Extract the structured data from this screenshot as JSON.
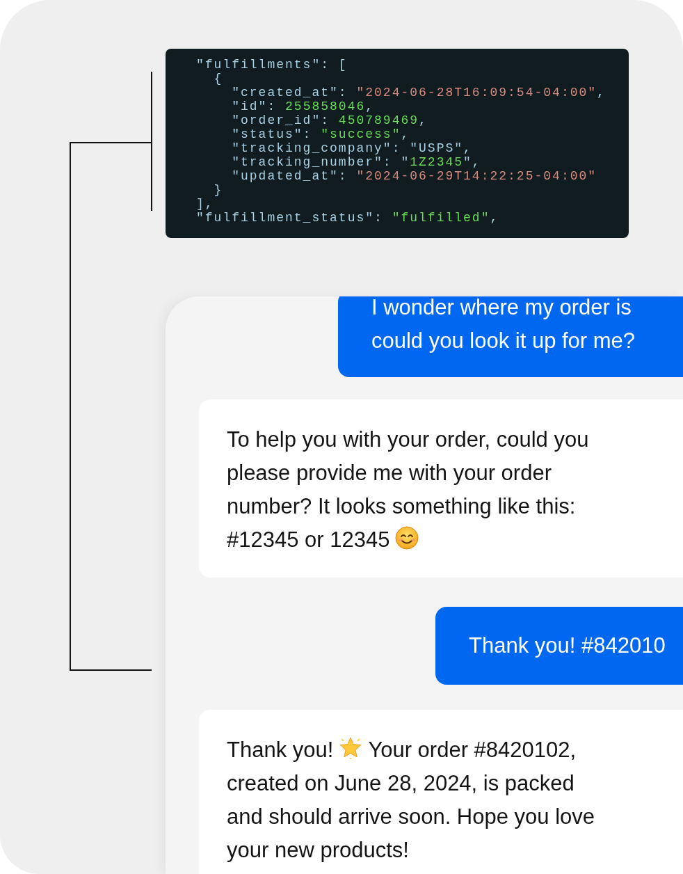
{
  "code_block": {
    "lines": [
      [
        {
          "kind": "plain",
          "text": "\"fulfillments\": ["
        }
      ],
      [
        {
          "kind": "plain",
          "text": "  {"
        }
      ],
      [
        {
          "kind": "plain",
          "text": "    \"created_at\": "
        },
        {
          "kind": "date",
          "text": "\"2024-06-28T16:09:54-04:00\""
        },
        {
          "kind": "plain",
          "text": ","
        }
      ],
      [
        {
          "kind": "plain",
          "text": "    \"id\": "
        },
        {
          "kind": "value",
          "text": "255858046"
        },
        {
          "kind": "plain",
          "text": ","
        }
      ],
      [
        {
          "kind": "plain",
          "text": "    \"order_id\": "
        },
        {
          "kind": "value",
          "text": "450789469"
        },
        {
          "kind": "plain",
          "text": ","
        }
      ],
      [
        {
          "kind": "plain",
          "text": "    \"status\": "
        },
        {
          "kind": "value",
          "text": "\"success\""
        },
        {
          "kind": "plain",
          "text": ","
        }
      ],
      [
        {
          "kind": "plain",
          "text": "    \"tracking_company\": \"USPS\","
        }
      ],
      [
        {
          "kind": "plain",
          "text": "    \"tracking_number\": \""
        },
        {
          "kind": "value",
          "text": "1Z2345"
        },
        {
          "kind": "plain",
          "text": "\","
        }
      ],
      [
        {
          "kind": "plain",
          "text": "    \"updated_at\": "
        },
        {
          "kind": "date",
          "text": "\"2024-06-29T14:22:25-04:00\""
        }
      ],
      [
        {
          "kind": "plain",
          "text": "  }"
        }
      ],
      [
        {
          "kind": "plain",
          "text": "],"
        }
      ],
      [
        {
          "kind": "plain",
          "text": "\"fulfillment_status\": "
        },
        {
          "kind": "value",
          "text": "\"fulfilled\""
        },
        {
          "kind": "plain",
          "text": ","
        }
      ]
    ]
  },
  "messages": [
    {
      "kind": "user",
      "segments": [
        {
          "kind": "para",
          "text": "I wonder where my order is\ncould you look it up for me?"
        }
      ]
    },
    {
      "kind": "bot",
      "segments": [
        {
          "kind": "para",
          "text": "To help you with your order, could you\nplease provide me with your order\nnumber? It looks something like this:"
        },
        {
          "kind": "text",
          "text": "#12345 or 12345"
        },
        {
          "kind": "smile"
        }
      ]
    },
    {
      "kind": "user",
      "segments": [
        {
          "kind": "text",
          "text": "Thank you! #842010"
        }
      ]
    },
    {
      "kind": "bot",
      "segments": [
        {
          "kind": "text",
          "text": "Thank you!"
        },
        {
          "kind": "star"
        },
        {
          "kind": "text",
          "text": "Your order #8420102,"
        },
        {
          "kind": "para",
          "text": "created on June 28, 2024, is packed\nand should arrive soon. Hope you love\nyour new products!"
        }
      ]
    }
  ]
}
